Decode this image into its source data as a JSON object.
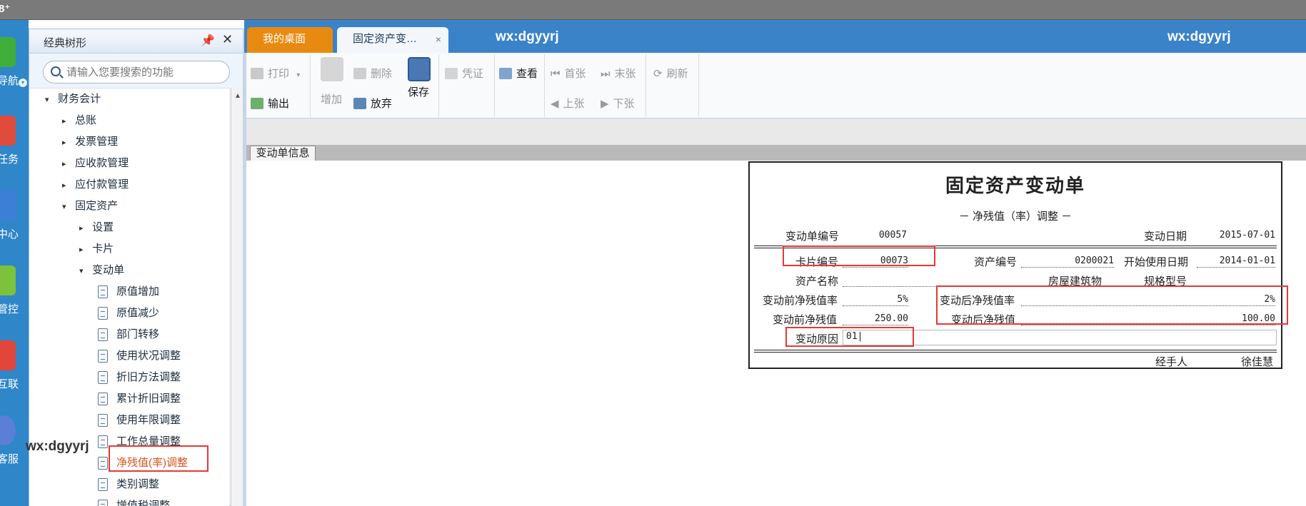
{
  "app": {
    "mark": "8⁺"
  },
  "rail": [
    {
      "label": "导航",
      "icon": "navigation-icon",
      "color": "#3fae3a"
    },
    {
      "label": "任务",
      "icon": "task-icon",
      "color": "#e14b3b"
    },
    {
      "label": "中心",
      "icon": "document-center-icon",
      "color": "#3b7fd6"
    },
    {
      "label": "管控",
      "icon": "gear-control-icon",
      "color": "#7cc23a"
    },
    {
      "label": "互联",
      "icon": "connect-icon",
      "color": "#e2463a"
    },
    {
      "label": "客服",
      "icon": "service-icon",
      "color": "#5a7fd6"
    }
  ],
  "tree": {
    "title": "经典树形",
    "search_placeholder": "请输入您要搜索的功能",
    "items": [
      {
        "label": "财务会计",
        "toggle": "▾"
      },
      {
        "label": "总账",
        "toggle": "▸"
      },
      {
        "label": "发票管理",
        "toggle": "▸"
      },
      {
        "label": "应收款管理",
        "toggle": "▸"
      },
      {
        "label": "应付款管理",
        "toggle": "▸"
      },
      {
        "label": "固定资产",
        "toggle": "▾"
      },
      {
        "label": "设置",
        "toggle": "▸"
      },
      {
        "label": "卡片",
        "toggle": "▸"
      },
      {
        "label": "变动单",
        "toggle": "▾"
      },
      {
        "label": "原值增加"
      },
      {
        "label": "原值减少"
      },
      {
        "label": "部门转移"
      },
      {
        "label": "使用状况调整"
      },
      {
        "label": "折旧方法调整"
      },
      {
        "label": "累计折旧调整"
      },
      {
        "label": "使用年限调整"
      },
      {
        "label": "工作总量调整"
      },
      {
        "label": "净残值(率)调整"
      },
      {
        "label": "类别调整"
      },
      {
        "label": "增值税调整"
      }
    ]
  },
  "watermarks": {
    "tree": "wx:dgyyrj",
    "tab": "wx:dgyyrj",
    "right": "wx:dgyyrj"
  },
  "tabs": [
    {
      "label": "我的桌面"
    },
    {
      "label": "固定资产变…",
      "close": "×"
    }
  ],
  "toolbar": {
    "print": "打印",
    "print_dropdown": "▾",
    "export": "输出",
    "add": "增加",
    "delete": "删除",
    "discard": "放弃",
    "save": "保存",
    "voucher": "凭证",
    "view": "查看",
    "first": "首张",
    "last": "末张",
    "prev": "上张",
    "next": "下张",
    "refresh": "刷新"
  },
  "section_tab": "变动单信息",
  "form": {
    "title": "固定资产变动单",
    "subtitle": "－ 净残值（率）调整 －",
    "change_no_label": "变动单编号",
    "change_no": "00057",
    "change_date_label": "变动日期",
    "change_date": "2015-07-01",
    "card_no_label": "卡片编号",
    "card_no": "00073",
    "asset_no_label": "资产编号",
    "asset_no": "0200021",
    "start_date_label": "开始使用日期",
    "start_date": "2014-01-01",
    "asset_name_label": "资产名称",
    "asset_name": "房屋建筑物",
    "spec_label": "规格型号",
    "spec": "",
    "before_rate_label": "变动前净残值率",
    "before_rate": "5%",
    "after_rate_label": "变动后净残值率",
    "after_rate": "2%",
    "before_value_label": "变动前净残值",
    "before_value": "250.00",
    "after_value_label": "变动后净残值",
    "after_value": "100.00",
    "reason_label": "变动原因",
    "reason": "01|",
    "handler_label": "经手人",
    "handler": "徐佳慧"
  },
  "colors": {
    "accent_blue": "#3b83c9",
    "home_tab": "#e98a10",
    "highlight": "#e53935",
    "active_tree_item": "#d9531e"
  }
}
